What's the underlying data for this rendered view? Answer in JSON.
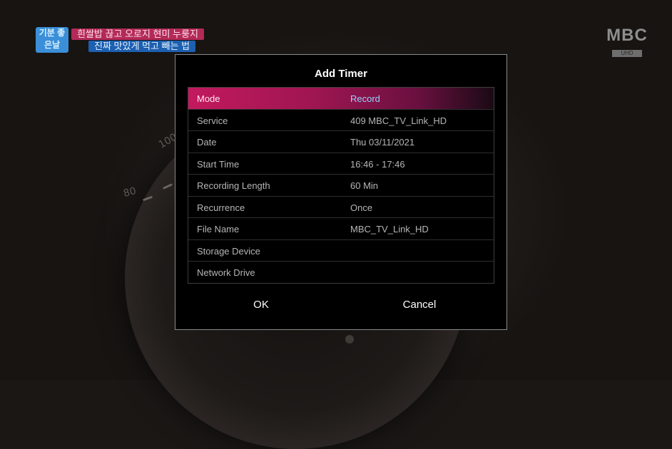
{
  "broadcast": {
    "tag": "기분 좋은날",
    "caption_line1": "흰쌀밥 끊고 오로지 현미 누룽지",
    "caption_line2": "진짜 맛있게 먹고 빼는 법",
    "channel_logo": "MBC",
    "channel_sub": "UHD",
    "dial_marks": [
      "100",
      "80"
    ]
  },
  "dialog": {
    "title": "Add Timer",
    "rows": [
      {
        "label": "Mode",
        "value": "Record",
        "selected": true
      },
      {
        "label": "Service",
        "value": "409 MBC_TV_Link_HD"
      },
      {
        "label": "Date",
        "value": "Thu 03/11/2021"
      },
      {
        "label": "Start Time",
        "value": "16:46 - 17:46"
      },
      {
        "label": "Recording Length",
        "value": "60 Min"
      },
      {
        "label": "Recurrence",
        "value": "Once"
      },
      {
        "label": "File Name",
        "value": "MBC_TV_Link_HD"
      },
      {
        "label": "Storage Device",
        "value": ""
      },
      {
        "label": "Network Drive",
        "value": ""
      }
    ],
    "ok_label": "OK",
    "cancel_label": "Cancel"
  },
  "colors": {
    "selected_row": "#c2195e",
    "selected_value": "#9ad0ff",
    "dialog_bg": "#000000"
  }
}
